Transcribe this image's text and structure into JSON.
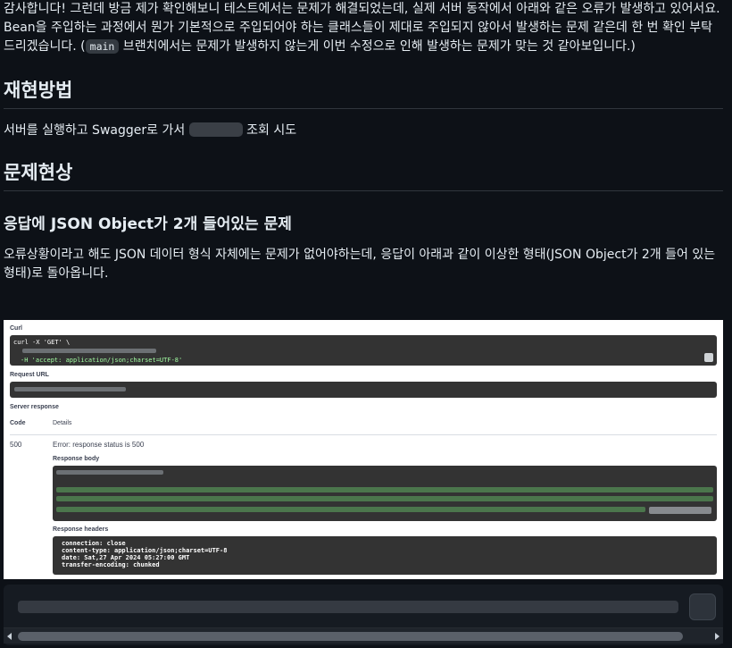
{
  "intro": {
    "text": "감사합니다! 그런데 방금 제가 확인해보니 테스트에서는 문제가 해결되었는데, 실제 서버 동작에서 아래와 같은 오류가 발생하고 있어서요. Bean을 주입하는 과정에서 뭔가 기본적으로 주입되어야 하는 클래스들이 제대로 주입되지 않아서 발생하는 문제 같은데 한 번 확인 부탁드리겠습니다. (",
    "code": "main",
    "suffix": " 브랜치에서는 문제가 발생하지 않는게 이번 수정으로 인해 발생하는 문제가 맞는 것 같아보입니다.)"
  },
  "repro": {
    "heading": "재현방법",
    "text_before": "서버를 실행하고 Swagger로 가서 ",
    "text_after": " 조회 시도"
  },
  "problem": {
    "heading": "문제현상",
    "subheading": "응답에 JSON Object가 2개 들어있는 문제",
    "text": "오류상황이라고 해도 JSON 데이터 형식 자체에는 문제가 없어야하는데, 응답이 아래과 같이 이상한 형태(JSON Object가 2개 들어 있는 형태)로 돌아옵니다."
  },
  "swagger": {
    "curl_label": "Curl",
    "curl_line1": "curl -X 'GET' \\",
    "curl_line3": "-H 'accept: application/json;charset=UTF-8'",
    "request_url_label": "Request URL",
    "server_response_label": "Server response",
    "code_col": "Code",
    "details_col": "Details",
    "status_code": "500",
    "error_text": "Error: response status is 500",
    "response_body_label": "Response body",
    "response_headers_label": "Response headers",
    "headers": [
      "connection: close",
      "content-type: application/json;charset=UTF-8",
      "date: Sat,27 Apr 2024 05:27:00 GMT",
      "transfer-encoding: chunked"
    ]
  },
  "colors": {
    "bg": "#0d1117",
    "text": "#e6edf3",
    "divider": "#30363d"
  }
}
